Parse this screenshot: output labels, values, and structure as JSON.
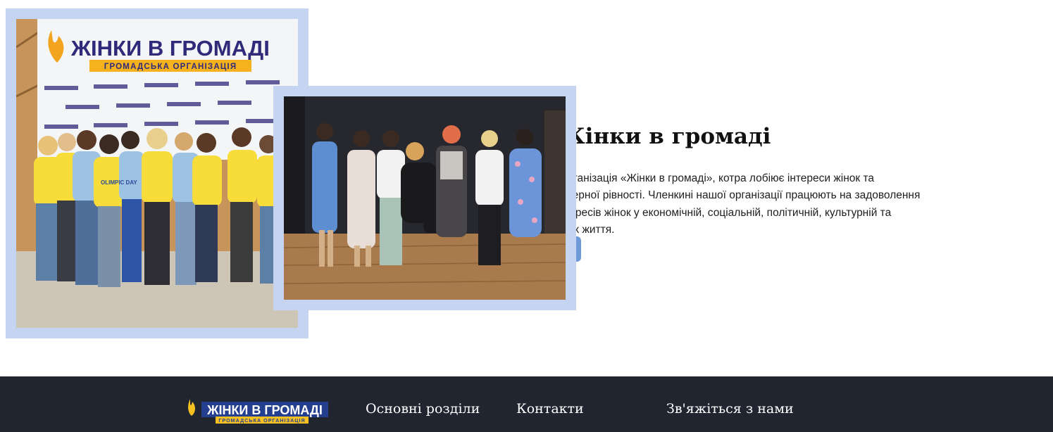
{
  "about": {
    "title": "Жінки в громаді",
    "text": "Громадська організація «Жінки в громаді», котра лобіює інтереси жінок та принципи гендерної рівності. Членкині нашої організації працюють на задоволення суспільних інтересів жінок у економічній, соціальній, політичній, культурній та освітній сферах життя.",
    "more_button_label": "",
    "photos": {
      "banner_title": "ЖІНКИ В ГРОМАДІ",
      "banner_subtitle": "ГРОМАДСЬКА ОРГАНІЗАЦІЯ",
      "shirt_text": "OLIMPIC DAY"
    }
  },
  "footer": {
    "logo": {
      "title": "ЖІНКИ В ГРОМАДІ",
      "subtitle": "ГРОМАДСЬКА ОРГАНІЗАЦІЯ"
    },
    "headings": {
      "sections": "Основні розділи",
      "contacts": "Контакти",
      "contact_us": "Зв'яжіться з нами"
    }
  },
  "colors": {
    "frame": "#c5d5f1",
    "accent_button": "#6d99d8",
    "footer_bg": "#212530",
    "logo_blue": "#243f8f",
    "logo_yellow": "#f6c020"
  }
}
